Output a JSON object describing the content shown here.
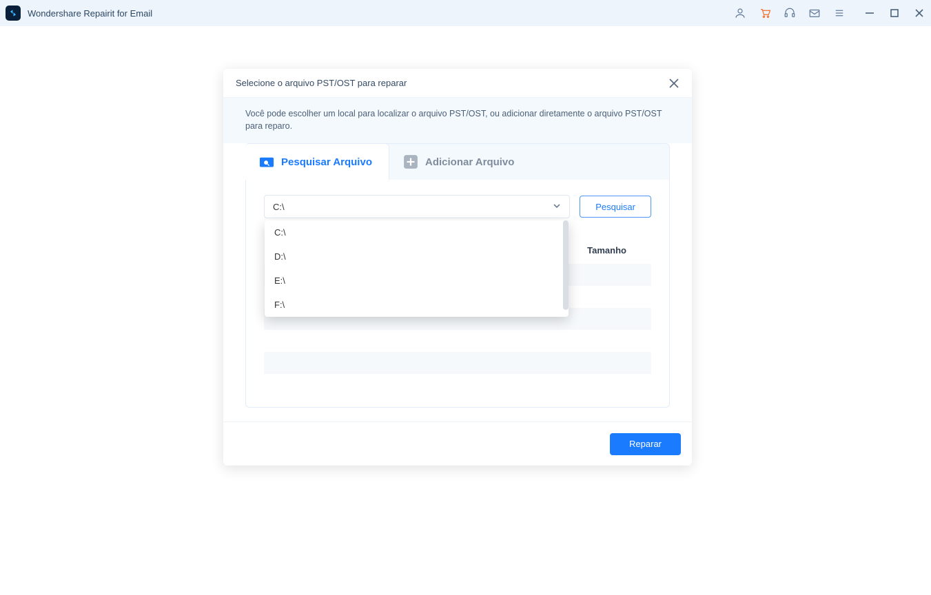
{
  "titlebar": {
    "app_name": "Wondershare Repairit for Email"
  },
  "modal": {
    "title": "Selecione o arquivo PST/OST para reparar",
    "description": "Você pode escolher um local para localizar o arquivo PST/OST, ou adicionar diretamente o arquivo PST/OST para reparo.",
    "tabs": {
      "search": "Pesquisar Arquivo",
      "add": "Adicionar Arquivo"
    },
    "drive_selected": "C:\\",
    "search_button": "Pesquisar",
    "dropdown_options": [
      "C:\\",
      "D:\\",
      "E:\\",
      "F:\\"
    ],
    "table": {
      "size_header": "Tamanho"
    },
    "repair_button": "Reparar"
  }
}
